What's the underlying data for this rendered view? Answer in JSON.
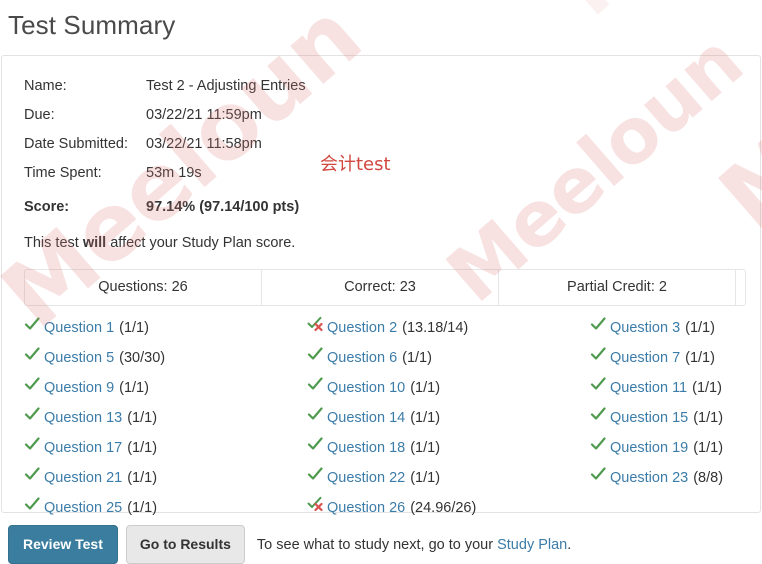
{
  "page": {
    "title": "Test Summary"
  },
  "summary": {
    "rows": [
      {
        "label": "Name:",
        "value": "Test 2 - Adjusting Entries"
      },
      {
        "label": "Due:",
        "value": "03/22/21 11:59pm"
      },
      {
        "label": "Date Submitted:",
        "value": "03/22/21 11:58pm"
      },
      {
        "label": "Time Spent:",
        "value": "53m 19s"
      }
    ],
    "score_label": "Score:",
    "score_value": "97.14% (97.14/100 pts)",
    "affect_prefix": "This test ",
    "affect_bold": "will",
    "affect_suffix": " affect your Study Plan score."
  },
  "stats": [
    {
      "label": "Questions: 26"
    },
    {
      "label": "Correct: 23"
    },
    {
      "label": "Partial Credit: 2"
    },
    {
      "label": ""
    }
  ],
  "questions": {
    "col1": [
      {
        "icon": "check-icon",
        "link": "Question 1",
        "points": "(1/1)"
      },
      {
        "icon": "check-icon",
        "link": "Question 5",
        "points": "(30/30)"
      },
      {
        "icon": "check-icon",
        "link": "Question 9",
        "points": "(1/1)"
      },
      {
        "icon": "check-icon",
        "link": "Question 13",
        "points": "(1/1)"
      },
      {
        "icon": "check-icon",
        "link": "Question 17",
        "points": "(1/1)"
      },
      {
        "icon": "check-icon",
        "link": "Question 21",
        "points": "(1/1)"
      },
      {
        "icon": "check-icon",
        "link": "Question 25",
        "points": "(1/1)"
      }
    ],
    "col2": [
      {
        "icon": "partial-credit-icon",
        "link": "Question 2",
        "points": "(13.18/14)"
      },
      {
        "icon": "check-icon",
        "link": "Question 6",
        "points": "(1/1)"
      },
      {
        "icon": "check-icon",
        "link": "Question 10",
        "points": "(1/1)"
      },
      {
        "icon": "check-icon",
        "link": "Question 14",
        "points": "(1/1)"
      },
      {
        "icon": "check-icon",
        "link": "Question 18",
        "points": "(1/1)"
      },
      {
        "icon": "check-icon",
        "link": "Question 22",
        "points": "(1/1)"
      },
      {
        "icon": "partial-credit-icon",
        "link": "Question 26",
        "points": "(24.96/26)"
      }
    ],
    "col3": [
      {
        "icon": "check-icon",
        "link": "Question 3",
        "points": "(1/1)"
      },
      {
        "icon": "check-icon",
        "link": "Question 7",
        "points": "(1/1)"
      },
      {
        "icon": "check-icon",
        "link": "Question 11",
        "points": "(1/1)"
      },
      {
        "icon": "check-icon",
        "link": "Question 15",
        "points": "(1/1)"
      },
      {
        "icon": "check-icon",
        "link": "Question 19",
        "points": "(1/1)"
      },
      {
        "icon": "check-icon",
        "link": "Question 23",
        "points": "(8/8)"
      }
    ]
  },
  "footer": {
    "review_label": "Review Test",
    "results_label": "Go to Results",
    "note_prefix": "To see what to study next, go to your ",
    "note_link": "Study Plan",
    "note_suffix": "."
  },
  "watermarks": {
    "brand": "Meeloun",
    "chinese": "会计test"
  },
  "colors": {
    "link": "#3c7ca8",
    "primary_button": "#3b7d9e",
    "check": "#4f9a4f",
    "cross": "#d9534f",
    "watermark": "#dc7878"
  }
}
